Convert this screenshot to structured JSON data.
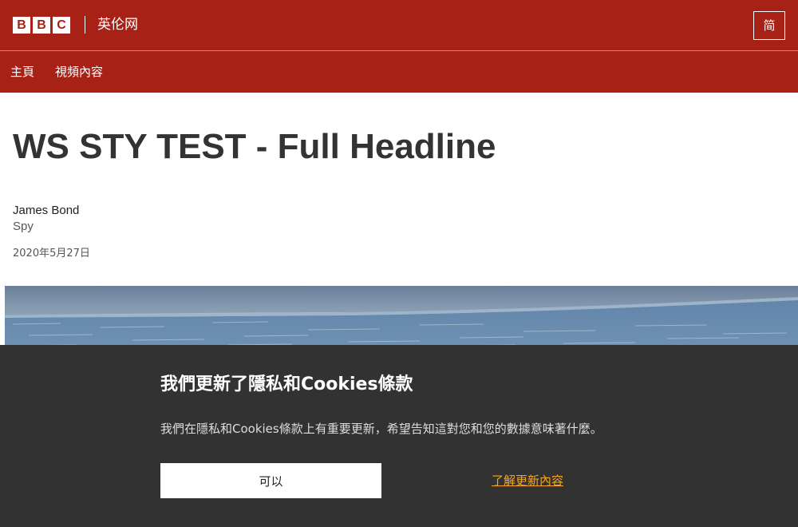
{
  "header": {
    "logo_letters": [
      "B",
      "B",
      "C"
    ],
    "service_name": "英伦网",
    "script_switch_label": "简",
    "brand_color": "#a82117"
  },
  "nav": {
    "items": [
      {
        "label": "主頁"
      },
      {
        "label": "視頻內容"
      }
    ]
  },
  "article": {
    "headline": "WS STY TEST - Full Headline",
    "author_name": "James Bond",
    "author_role": "Spy",
    "date": "2020年5月27日"
  },
  "cookie_banner": {
    "title": "我們更新了隱私和Cookies條款",
    "body": "我們在隱私和Cookies條款上有重要更新，希望告知這對您和您的數據意味著什麼。",
    "accept_label": "可以",
    "learn_more_label": "了解更新內容",
    "background_color": "#323232",
    "link_color": "#f5a623"
  }
}
